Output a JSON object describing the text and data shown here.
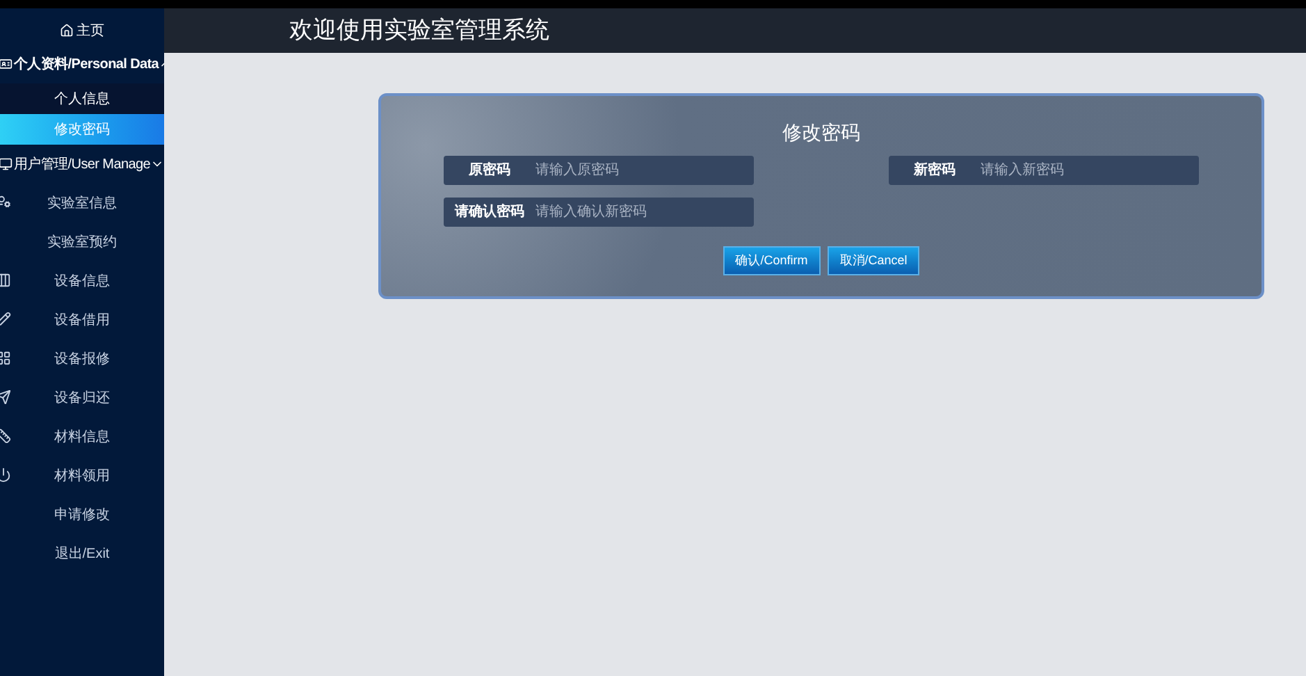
{
  "header": {
    "title": "欢迎使用实验室管理系统"
  },
  "sidebar": {
    "items": [
      {
        "kind": "home",
        "label": "主页"
      },
      {
        "kind": "group",
        "label": "个人资料/Personal Data",
        "expanded": true,
        "children": [
          {
            "label": "个人信息",
            "selected": false
          },
          {
            "label": "修改密码",
            "selected": true
          }
        ]
      },
      {
        "kind": "group",
        "label": "用户管理/User Manage",
        "expanded": false
      },
      {
        "kind": "item",
        "label": "实验室信息"
      },
      {
        "kind": "item",
        "label": "实验室预约"
      },
      {
        "kind": "item",
        "label": "设备信息"
      },
      {
        "kind": "item",
        "label": "设备借用"
      },
      {
        "kind": "item",
        "label": "设备报修"
      },
      {
        "kind": "item",
        "label": "设备归还"
      },
      {
        "kind": "item",
        "label": "材料信息"
      },
      {
        "kind": "item",
        "label": "材料领用"
      },
      {
        "kind": "item",
        "label": "申请修改"
      },
      {
        "kind": "item",
        "label": "退出/Exit"
      }
    ]
  },
  "form": {
    "title": "修改密码",
    "fields": [
      {
        "label": "原密码",
        "placeholder": "请输入原密码"
      },
      {
        "label": "新密码",
        "placeholder": "请输入新密码"
      },
      {
        "label": "请确认密码",
        "placeholder": "请输入确认新密码"
      }
    ],
    "buttons": [
      {
        "label": "确认/Confirm"
      },
      {
        "label": "取消/Cancel"
      }
    ]
  }
}
